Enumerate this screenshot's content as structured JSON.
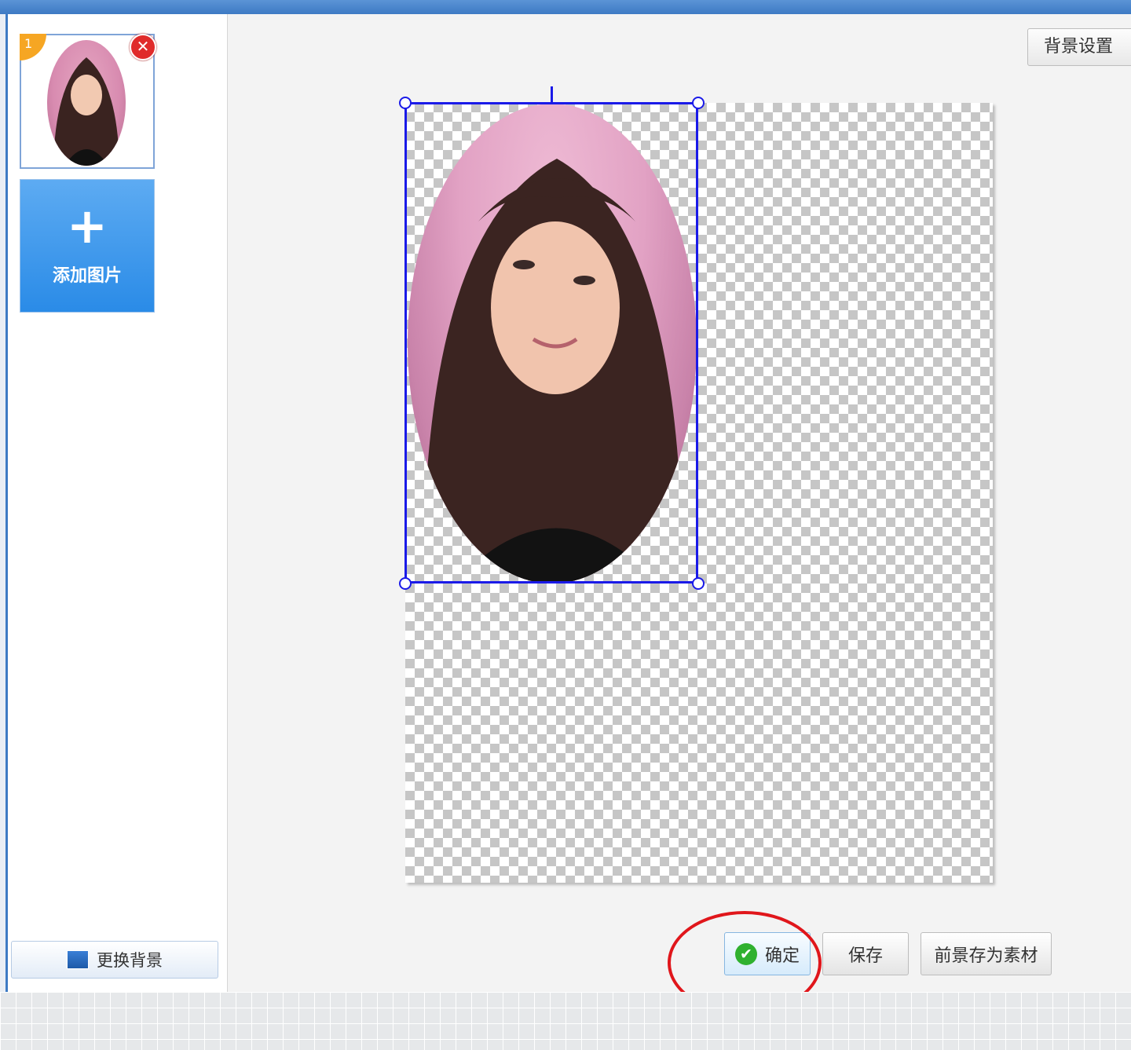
{
  "sidebar": {
    "thumbnail": {
      "number": "1",
      "delete_icon": "close-icon"
    },
    "add_button": {
      "icon": "plus-icon",
      "label": "添加图片"
    },
    "change_background": {
      "icon": "background-image-icon",
      "label": "更换背景"
    }
  },
  "toolbar": {
    "background_settings_label": "背景设置"
  },
  "canvas": {
    "background": "transparent-checkerboard",
    "photo_shape": "ellipse"
  },
  "actions": {
    "confirm_label": "确定",
    "confirm_icon": "check-circle-icon",
    "save_label": "保存",
    "save_foreground_label": "前景存为素材"
  },
  "colors": {
    "accent_blue": "#2a8be7",
    "selection_blue": "#1a1ae8",
    "confirm_green": "#2fb12f",
    "annotation_red": "#e0161b",
    "badge_orange": "#f6a623"
  }
}
